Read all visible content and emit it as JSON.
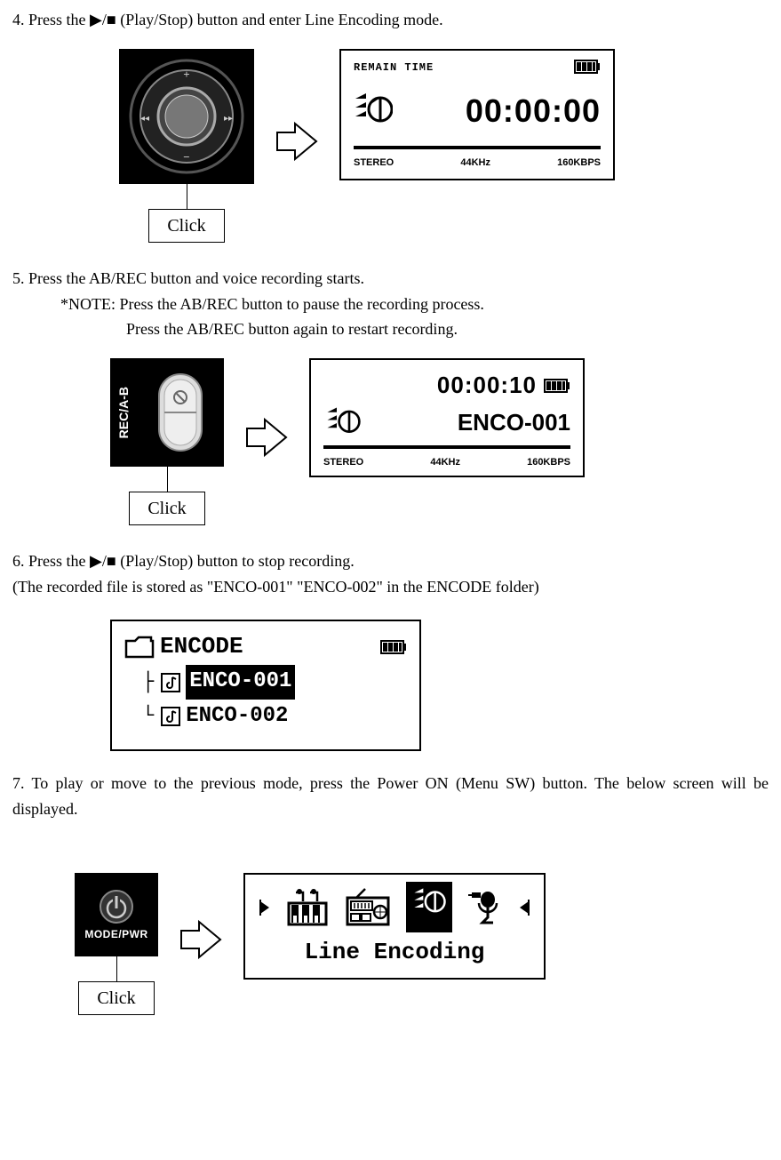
{
  "step4": {
    "text": "4. Press the ▶/■ (Play/Stop) button and enter Line Encoding mode.",
    "click": "Click",
    "lcd": {
      "label": "REMAIN TIME",
      "time": "00:00:00",
      "stereo": "STEREO",
      "khz": "44KHz",
      "bitrate": "160KBPS"
    }
  },
  "step5": {
    "line1": "5. Press the AB/REC button and voice recording starts.",
    "note": "*NOTE: Press the AB/REC button to pause the recording process.",
    "note2": "Press the AB/REC button again to restart recording.",
    "click": "Click",
    "rec_side": "REC/A-B",
    "lcd": {
      "time": "00:00:10",
      "title": "ENCO-001",
      "stereo": "STEREO",
      "khz": "44KHz",
      "bitrate": "160KBPS"
    }
  },
  "step6": {
    "line1": "6.  Press the ▶/■ (Play/Stop) button to stop recording.",
    "line2": "(The recorded file is stored as \"ENCO-001\" \"ENCO-002\" in the ENCODE folder)",
    "encode": {
      "folder": "ENCODE",
      "file1": "ENCO-001",
      "file2": "ENCO-002"
    }
  },
  "step7": {
    "text": "7. To play or move to the previous mode, press the Power ON (Menu SW) button. The below screen will be displayed.",
    "click": "Click",
    "mode_label": "MODE/PWR",
    "menu_title": "Line Encoding"
  }
}
